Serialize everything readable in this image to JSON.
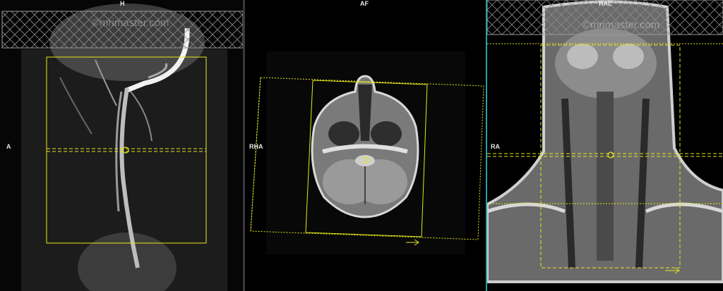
{
  "viewports": [
    {
      "top_label": "H",
      "left_label": "A",
      "watermark": "©mrimaster.com"
    },
    {
      "top_label": "AF",
      "left_label": "RHA",
      "watermark": ""
    },
    {
      "top_label": "HAL",
      "left_label": "RA",
      "watermark": "©mrimaster.com"
    }
  ],
  "colors": {
    "planning_box": "#e6e61e",
    "divider": "#3a3a3a",
    "accent_line": "#2a9fa8"
  }
}
